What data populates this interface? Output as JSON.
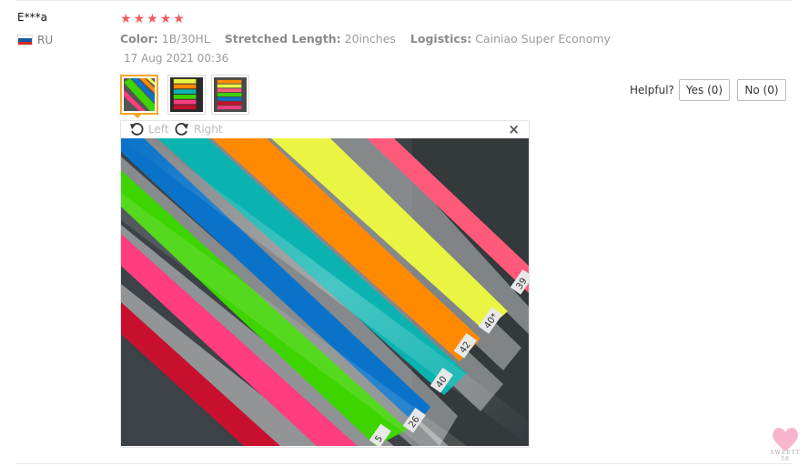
{
  "review": {
    "user_name": "E***a",
    "country_code": "RU",
    "rating": 5,
    "stars": [
      "★",
      "★",
      "★",
      "★",
      "★"
    ],
    "color_label": "Color:",
    "color_value": "1B/30HL",
    "length_label": "Stretched Length:",
    "length_value": "20inches",
    "logistics_label": "Logistics:",
    "logistics_value": "Cainiao Super Economy",
    "date": "17 Aug 2021 00:36"
  },
  "helpful": {
    "label": "Helpful?",
    "yes_label": "Yes (0)",
    "no_label": "No (0)"
  },
  "viewer": {
    "rotate_left_label": "Left",
    "rotate_right_label": "Right",
    "close_glyph": "×",
    "tag_labels": [
      "5",
      "26",
      "40",
      "42",
      "40*",
      "39"
    ]
  },
  "watermark": {
    "text": "SWEETT 58"
  },
  "colors": {
    "star": "#f25c5c",
    "accent_orange": "#f5a623",
    "hair_strips": [
      "#c8102e",
      "#ff3d7f",
      "#3ed400",
      "#0a73c9",
      "#0bb3b0",
      "#ff8a00",
      "#e9f542",
      "#ff5a7a"
    ]
  }
}
